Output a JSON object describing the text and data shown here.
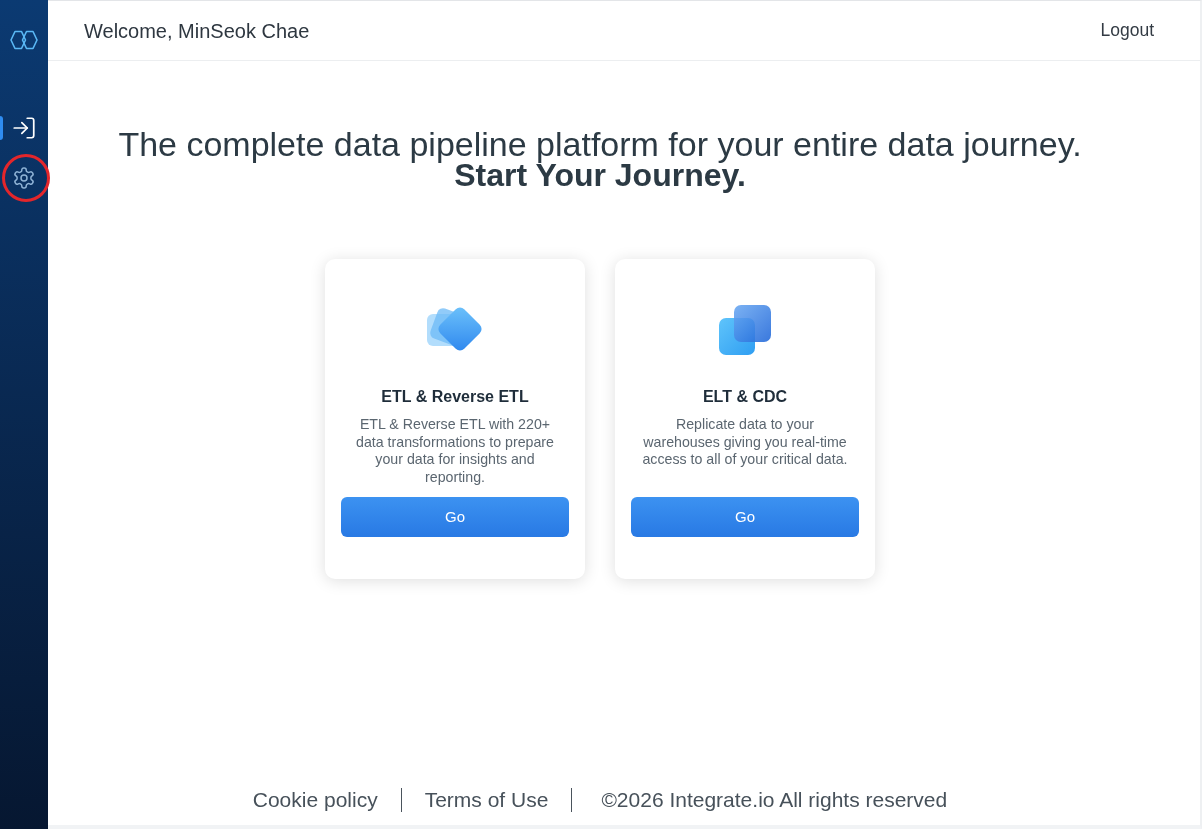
{
  "sidebar": {
    "items": [
      {
        "kind": "login",
        "selected": true,
        "highlighted": false
      },
      {
        "kind": "settings",
        "selected": false,
        "highlighted": true
      }
    ]
  },
  "header": {
    "welcome": "Welcome, MinSeok Chae",
    "logout": "Logout"
  },
  "hero": {
    "headline": "The complete data pipeline platform for your entire data journey.",
    "subheadline": "Start Your Journey."
  },
  "cards": [
    {
      "kind": "layers",
      "title": "ETL & Reverse ETL",
      "description": "ETL & Reverse ETL with 220+ data transformations to prepare your data for insights and reporting.",
      "button": "Go"
    },
    {
      "kind": "squares",
      "title": "ELT & CDC",
      "description": "Replicate data to your warehouses giving you real-time access to all of your critical data.",
      "button": "Go"
    }
  ],
  "footer": {
    "links": [
      "Cookie policy",
      "Terms of Use"
    ],
    "copyright": "©2026 Integrate.io All rights reserved"
  }
}
